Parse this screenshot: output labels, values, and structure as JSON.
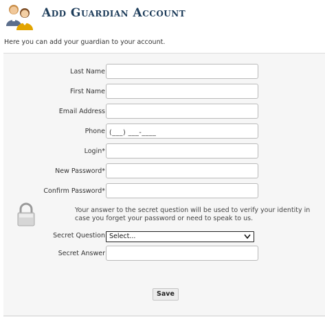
{
  "header": {
    "title": "Add Guardian Account",
    "icon": "users-icon"
  },
  "intro_text": "Here you can add your guardian to your account.",
  "form": {
    "fields": [
      {
        "label": "Last Name",
        "value": ""
      },
      {
        "label": "First Name",
        "value": ""
      },
      {
        "label": "Email Address",
        "value": ""
      },
      {
        "label": "Phone",
        "value": "(___) ___-____"
      },
      {
        "label": "Login*",
        "value": ""
      },
      {
        "label": "New Password*",
        "value": ""
      },
      {
        "label": "Confirm Password*",
        "value": ""
      }
    ],
    "secret_note": "Your answer to the secret question will be used to verify your identity in case you forget your password or need to speak to us.",
    "secret_question": {
      "label": "Secret Question",
      "selected": "Select..."
    },
    "secret_answer": {
      "label": "Secret Answer",
      "value": ""
    },
    "save_label": "Save"
  },
  "colors": {
    "title": "#1d3c5a",
    "panel_background": "#f6f6f6"
  }
}
